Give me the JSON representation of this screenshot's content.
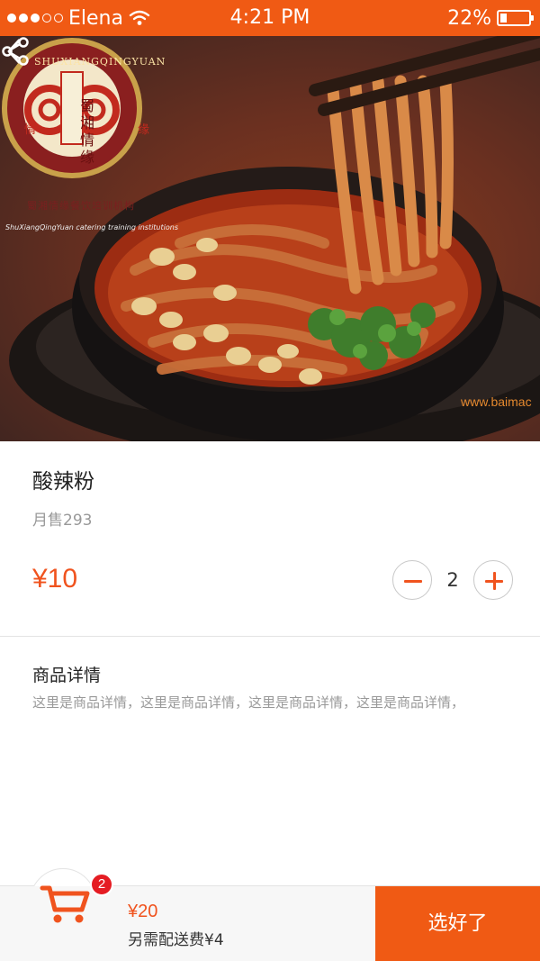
{
  "status_bar": {
    "carrier": "Elena",
    "time": "4:21 PM",
    "battery_percent": "22%",
    "battery_level": 0.22,
    "signal_bars_filled": 3,
    "signal_bars_total": 5
  },
  "hero": {
    "logo_text_en": "SHUXIANGQINGYUAN",
    "logo_text_cn": "蜀湘情缘",
    "logo_side_left": "情",
    "logo_side_right": "缘",
    "logo_caption_cn": "蜀湘情缘餐饮培训机构",
    "logo_caption_en": "ShuXiangQingYuan catering training institutions",
    "watermark": "www.baimac"
  },
  "product": {
    "name": "酸辣粉",
    "monthly_sales": "月售293",
    "price": "¥10",
    "quantity": "2",
    "detail_title": "商品详情",
    "detail_text": "这里是商品详情，这里是商品详情，这里是商品详情，这里是商品详情，"
  },
  "cart": {
    "badge_count": "2",
    "total": "¥20",
    "delivery_fee": "另需配送费¥4",
    "confirm_label": "选好了"
  },
  "colors": {
    "accent": "#f05a14",
    "price": "#f0531e",
    "badge": "#e51c23"
  }
}
